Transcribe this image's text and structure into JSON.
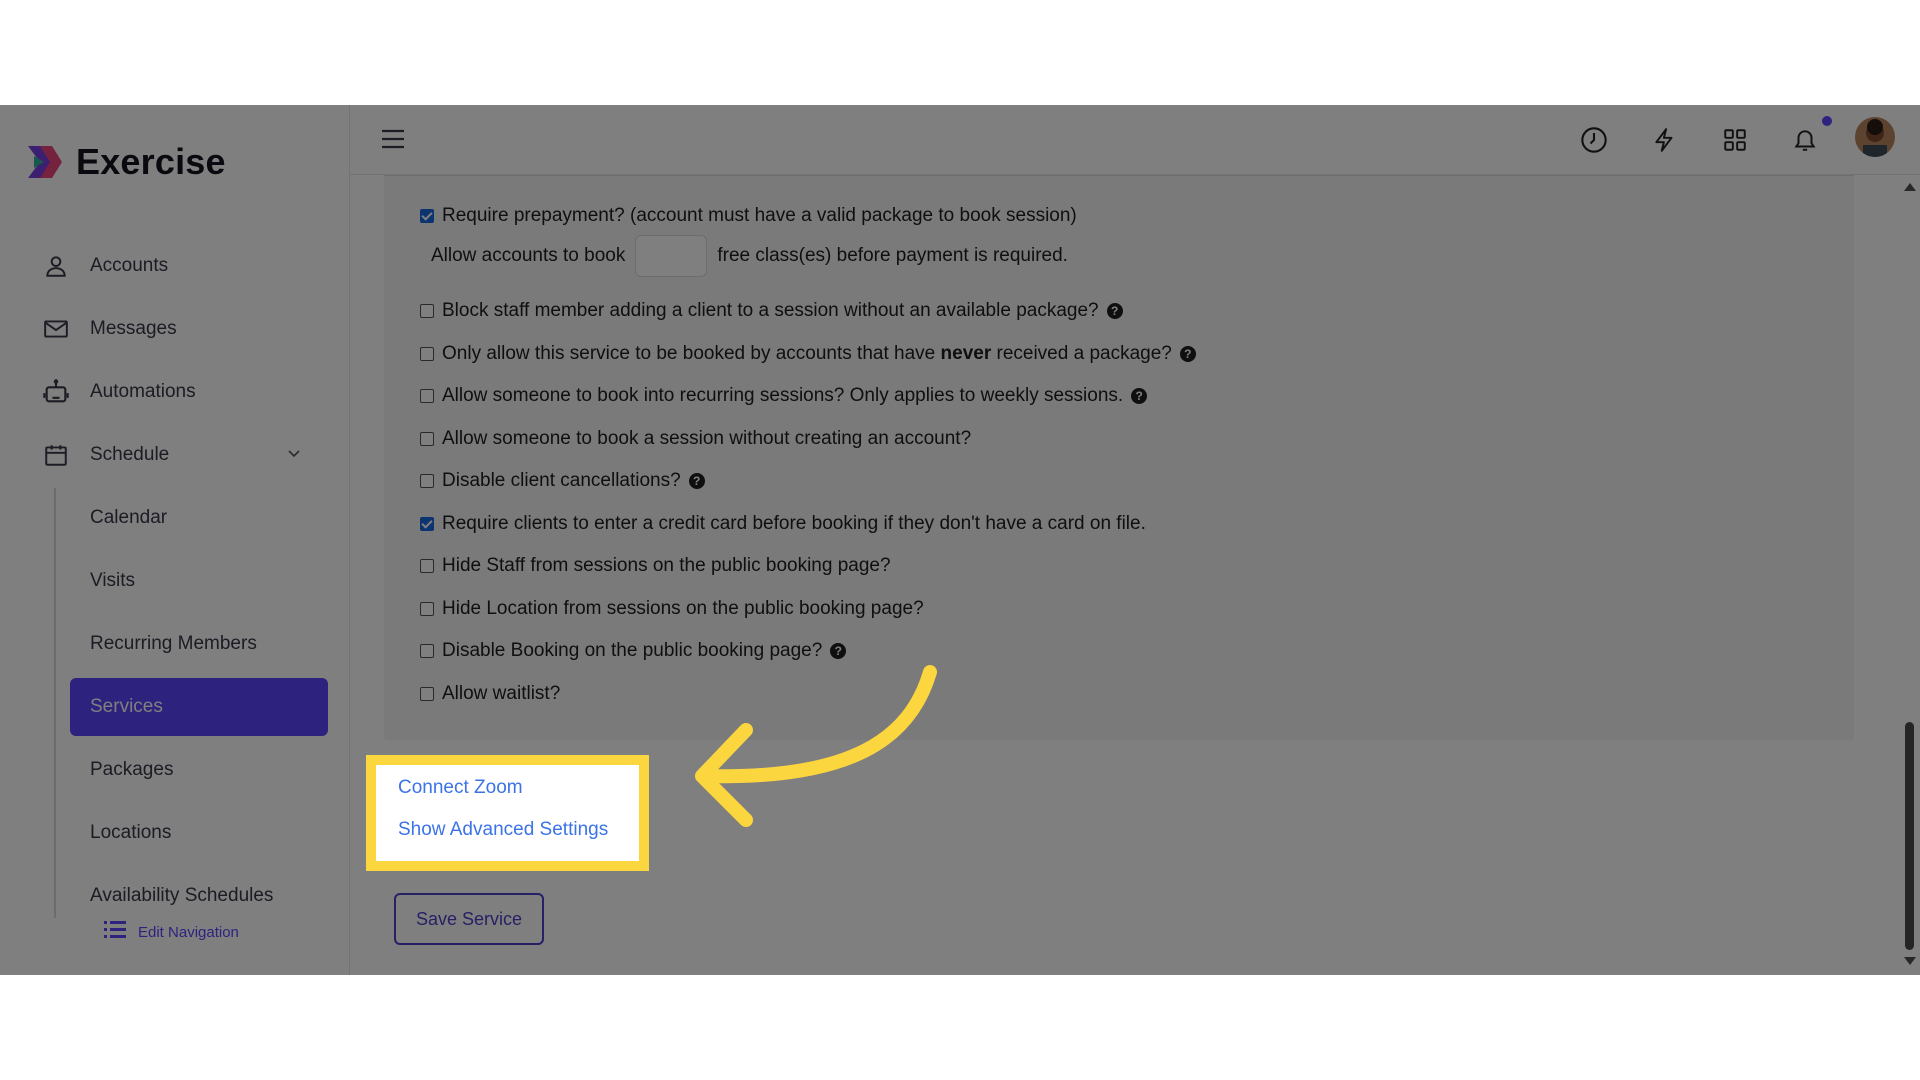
{
  "app": {
    "title": "Exercise"
  },
  "sidebar": {
    "items": [
      {
        "label": "Accounts",
        "icon": "user-icon"
      },
      {
        "label": "Messages",
        "icon": "mail-icon"
      },
      {
        "label": "Automations",
        "icon": "robot-icon"
      },
      {
        "label": "Schedule",
        "icon": "calendar-icon"
      }
    ],
    "schedule_sub": [
      {
        "label": "Calendar"
      },
      {
        "label": "Visits"
      },
      {
        "label": "Recurring Members"
      },
      {
        "label": "Services",
        "active": true
      },
      {
        "label": "Packages"
      },
      {
        "label": "Locations"
      },
      {
        "label": "Availability Schedules"
      }
    ],
    "edit_navigation": "Edit Navigation"
  },
  "topbar": {
    "icons": [
      "menu-icon",
      "clock-icon",
      "lightning-icon",
      "grid-icon",
      "bell-icon",
      "avatar"
    ],
    "notification_dot_color": "#5c45ff"
  },
  "options": {
    "require_prepayment": {
      "label": "Require prepayment? (account must have a valid package to book session)",
      "checked": true
    },
    "free_classes": {
      "before": "Allow accounts to book",
      "value": "",
      "after": "free class(es) before payment is required."
    },
    "block_staff": {
      "label": "Block staff member adding a client to a session without an available package?",
      "checked": false
    },
    "never_received": {
      "before": "Only allow this service to be booked by accounts that have",
      "bold": "never",
      "after": "received a package?",
      "checked": false
    },
    "recurring": {
      "label": "Allow someone to book into recurring sessions? Only applies to weekly sessions.",
      "checked": false
    },
    "without_account": {
      "label": "Allow someone to book a session without creating an account?",
      "checked": false
    },
    "disable_cancellations": {
      "label": "Disable client cancellations?",
      "checked": false
    },
    "require_card": {
      "label": "Require clients to enter a credit card before booking if they don't have a card on file.",
      "checked": true
    },
    "hide_staff": {
      "label": "Hide Staff from sessions on the public booking page?",
      "checked": false
    },
    "hide_location": {
      "label": "Hide Location from sessions on the public booking page?",
      "checked": false
    },
    "disable_booking": {
      "label": "Disable Booking on the public booking page?",
      "checked": false
    },
    "waitlist": {
      "label": "Allow waitlist?",
      "checked": false
    }
  },
  "links": {
    "connect_zoom": "Connect Zoom",
    "advanced_settings": "Show Advanced Settings"
  },
  "save_button": "Save Service",
  "colors": {
    "accent": "#5c45ff",
    "link": "#3b73e8",
    "highlight": "#fcd63e"
  }
}
